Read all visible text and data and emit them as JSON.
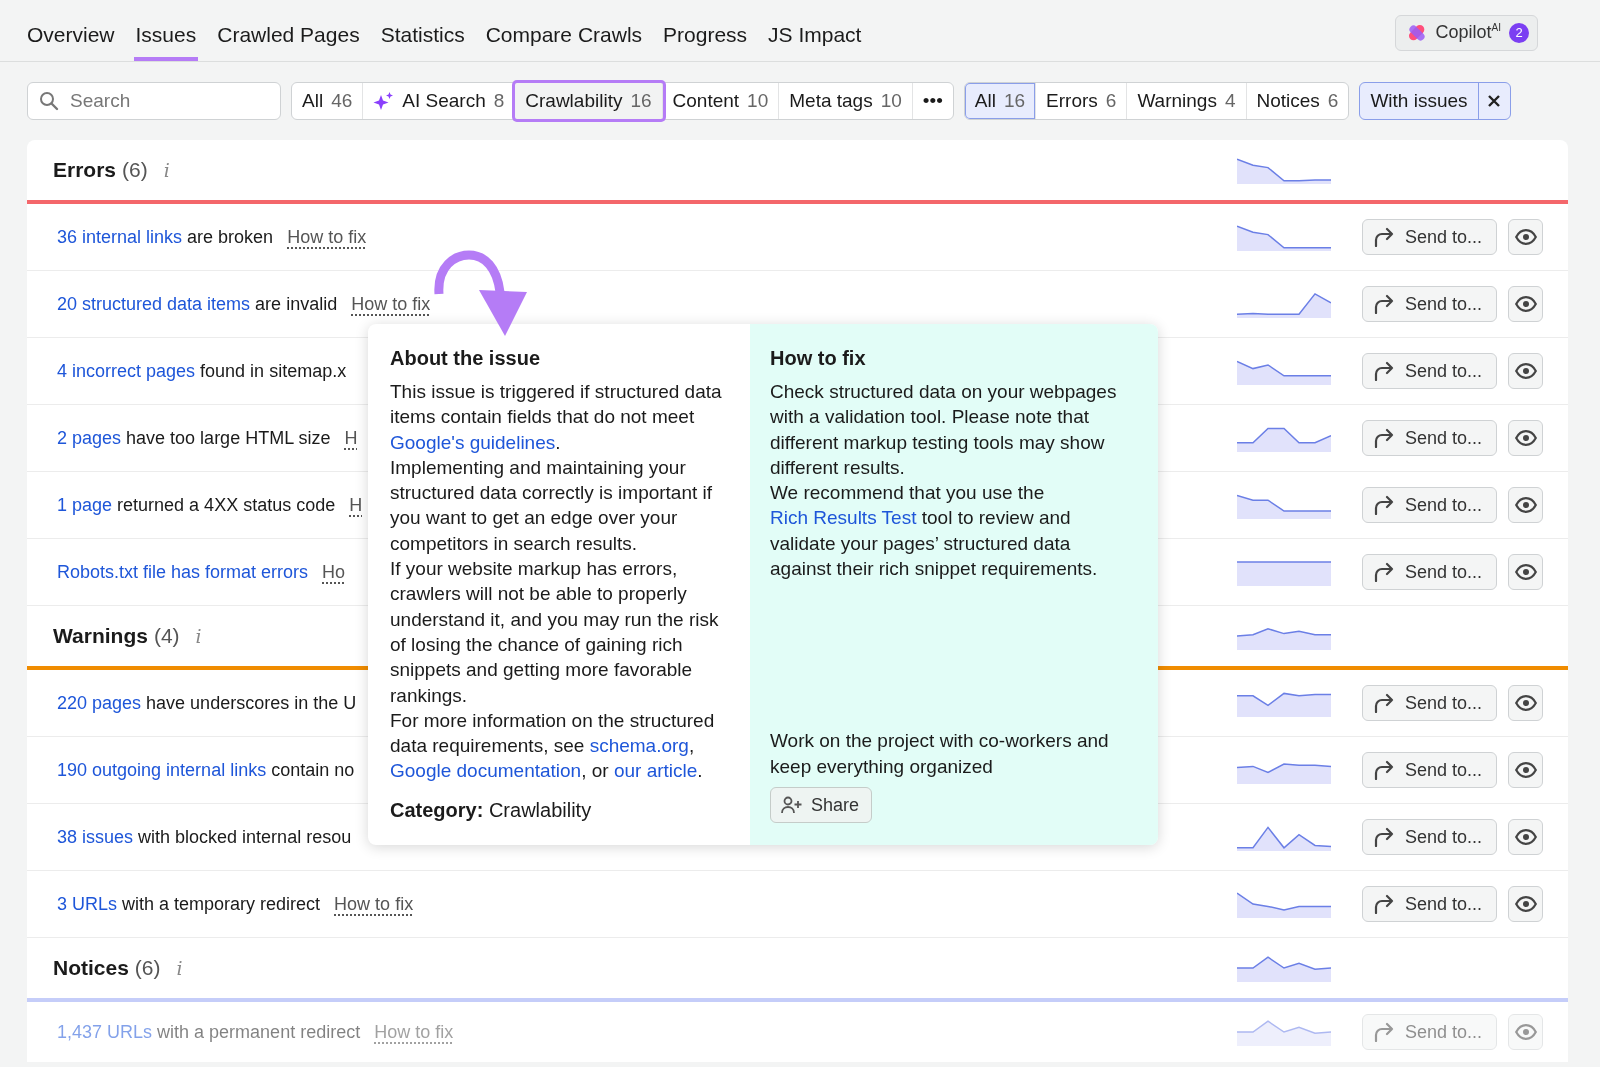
{
  "tabs": [
    {
      "label": "Overview",
      "selected": false
    },
    {
      "label": "Issues",
      "selected": true
    },
    {
      "label": "Crawled Pages",
      "selected": false
    },
    {
      "label": "Statistics",
      "selected": false
    },
    {
      "label": "Compare Crawls",
      "selected": false
    },
    {
      "label": "Progress",
      "selected": false
    },
    {
      "label": "JS Impact",
      "selected": false
    }
  ],
  "copilot": {
    "label": "Copilot$^{AI}$",
    "badge": "2"
  },
  "search": {
    "placeholder": "Search"
  },
  "categories": [
    {
      "kind": "plain",
      "label": "All",
      "count": "46",
      "selected": false
    },
    {
      "kind": "ai",
      "label": "AI Search",
      "count": "8",
      "selected": false
    },
    {
      "kind": "plain",
      "label": "Crawlability",
      "count": "16",
      "selected": true
    },
    {
      "kind": "plain",
      "label": "Content",
      "count": "10",
      "selected": false
    },
    {
      "kind": "plain",
      "label": "Meta tags",
      "count": "10",
      "selected": false
    }
  ],
  "more": "•••",
  "severities": [
    {
      "label": "All",
      "count": "16",
      "selected": true
    },
    {
      "label": "Errors",
      "count": "6",
      "selected": false
    },
    {
      "label": "Warnings",
      "count": "4",
      "selected": false
    },
    {
      "label": "Notices",
      "count": "6",
      "selected": false
    }
  ],
  "filter_chip": {
    "label": "With issues"
  },
  "sections": [
    {
      "kind": "error",
      "title": "Errors",
      "count": "(6)",
      "info": "i",
      "rows": [
        {
          "link": "36 internal links",
          "text": "are broken",
          "fix": "How to fix",
          "send": "Send to...",
          "faded": false
        },
        {
          "link": "20 structured data items",
          "text": "are invalid",
          "fix": "How to fix",
          "send": "Send to...",
          "faded": false
        },
        {
          "link": "4 incorrect pages",
          "text": "found in sitemap.x",
          "send": "Send to...",
          "faded": false
        },
        {
          "link": "2 pages",
          "text": "have too large HTML size",
          "fix": "H",
          "send": "Send to...",
          "faded": false
        },
        {
          "link": "1 page",
          "text": "returned a 4XX status code",
          "fix": "H",
          "send": "Send to...",
          "faded": false
        },
        {
          "link": "Robots.txt file has format errors",
          "fix": "Ho",
          "send": "Send to...",
          "faded": false
        }
      ]
    },
    {
      "kind": "warning",
      "title": "Warnings",
      "count": "(4)",
      "info": "i",
      "rows": [
        {
          "link": "220 pages",
          "text": "have underscores in the U",
          "send": "Send to...",
          "faded": false
        },
        {
          "link": "190 outgoing internal links",
          "text": "contain no",
          "send": "Send to...",
          "faded": false
        },
        {
          "link": "38 issues",
          "text": "with blocked internal resou",
          "send": "Send to...",
          "faded": false
        },
        {
          "link": "3 URLs",
          "text": "with a temporary redirect",
          "fix": "How to fix",
          "send": "Send to...",
          "faded": false
        }
      ]
    },
    {
      "kind": "notice",
      "title": "Notices",
      "count": "(6)",
      "info": "i",
      "rows": [
        {
          "link": "1,437 URLs",
          "text": "with a permanent redirect",
          "fix": "How to fix",
          "send": "Send to...",
          "faded": true
        }
      ]
    }
  ],
  "popover": {
    "about": {
      "title": "About the issue",
      "paragraphs": [
        [
          {
            "kind": "text",
            "text": "This issue is triggered if structured data items contain fields that do not meet "
          },
          {
            "kind": "link",
            "text": "Google's guidelines"
          },
          {
            "kind": "text",
            "text": "."
          }
        ],
        [
          {
            "kind": "text",
            "text": "Implementing and maintaining your structured data correctly is important if you want to get an edge over your competitors in search results."
          }
        ],
        [
          {
            "kind": "text",
            "text": "If your website markup has errors, crawlers will not be able to properly understand it, and you may run the risk of losing the chance of gaining rich snippets and getting more favorable rankings."
          }
        ],
        [
          {
            "kind": "text",
            "text": "For more information on the structured data requirements, see "
          },
          {
            "kind": "link",
            "text": "schema.org"
          },
          {
            "kind": "text",
            "text": ", "
          },
          {
            "kind": "link",
            "text": "Google documentation"
          },
          {
            "kind": "text",
            "text": ", or "
          },
          {
            "kind": "link",
            "text": "our article"
          },
          {
            "kind": "text",
            "text": "."
          }
        ]
      ],
      "category_label": "Category:",
      "category": "Crawlability"
    },
    "fix": {
      "title": "How to fix",
      "paragraphs": [
        [
          {
            "kind": "text",
            "text": "Check structured data on your webpages with a validation tool. Please note that different markup testing tools may show different results."
          }
        ],
        [
          {
            "kind": "text",
            "text": "We recommend that you use the "
          },
          {
            "kind": "link",
            "text": "Rich Results Test"
          },
          {
            "kind": "text",
            "text": " tool to review and validate your pages’ structured data against their rich snippet requirements."
          }
        ]
      ],
      "cta": "Work on the project with co-workers and keep everything organized",
      "share": "Share"
    }
  }
}
